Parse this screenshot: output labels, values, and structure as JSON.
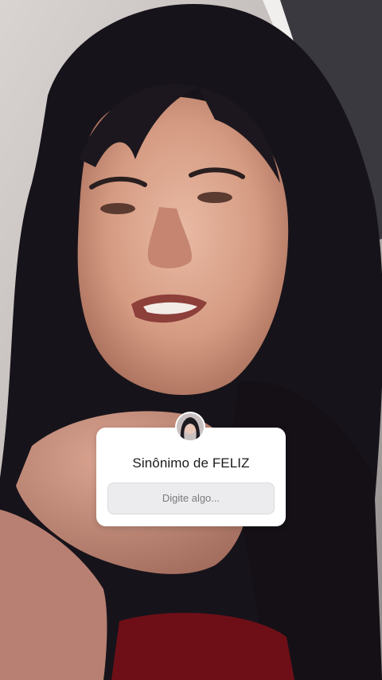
{
  "question_sticker": {
    "question": "Sinônimo de FELIZ",
    "placeholder": "Digite algo..."
  },
  "icons": {
    "avatar": "profile-avatar"
  },
  "colors": {
    "card_background": "#ffffff",
    "input_background": "#ececee",
    "question_text": "#1a1a1a",
    "placeholder_text": "#7a7a7f"
  }
}
